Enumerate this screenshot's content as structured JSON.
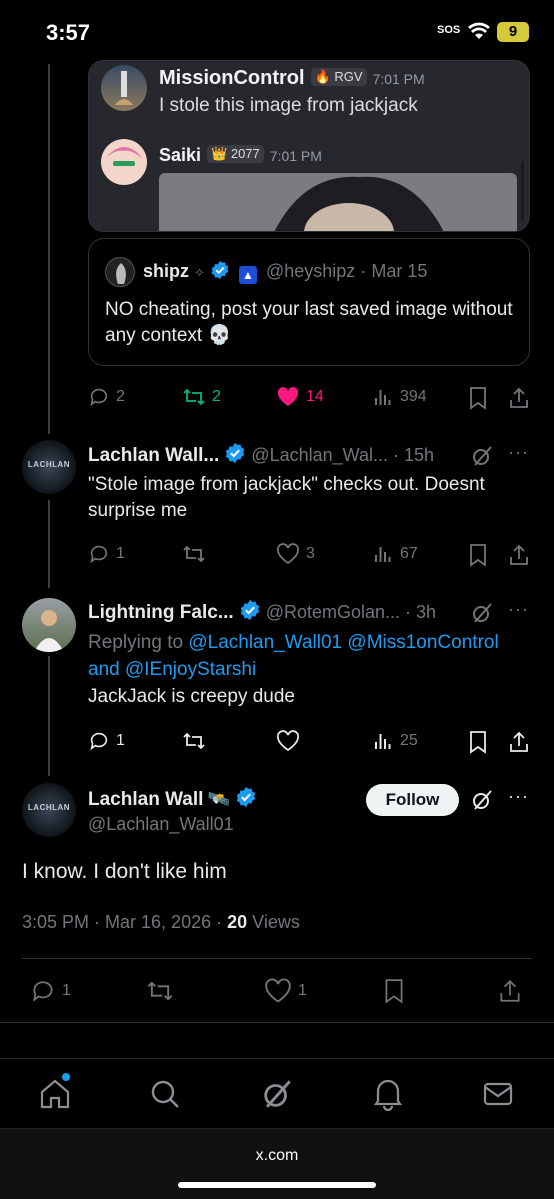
{
  "status_bar": {
    "time": "3:57",
    "sos": "SOS",
    "battery": "9"
  },
  "embedded_image": {
    "messages": [
      {
        "name": "MissionControl",
        "tag": "RGV",
        "time": "7:01 PM",
        "text": "I stole this image from jackjack"
      },
      {
        "name": "Saiki",
        "tag": "2077",
        "time": "7:01 PM"
      }
    ]
  },
  "quoted_tweet": {
    "name": "shipz",
    "handle": "@heyshipz",
    "date": "· Mar 15",
    "text": "NO cheating, post your last saved image without any context 💀"
  },
  "original_actions": {
    "replies": "2",
    "reposts": "2",
    "likes": "14",
    "views": "394"
  },
  "replies": [
    {
      "name": "Lachlan Wall...",
      "handle": "@Lachlan_Wal...",
      "time": "· 15h",
      "text": "\"Stole image from jackjack\" checks out. Doesnt surprise me",
      "replies": "1",
      "reposts": "",
      "likes": "3",
      "views": "67"
    },
    {
      "name": "Lightning Falc...",
      "handle": "@RotemGolan...",
      "time": "· 3h",
      "replying_to_label": "Replying to",
      "replying_to_1": "@Lachlan_Wall01",
      "replying_to_2": "@Miss1onControl",
      "and_label": "and",
      "replying_to_3": "@IEnjoyStarshi",
      "text": "JackJack is creepy dude",
      "replies": "1",
      "reposts": "",
      "likes": "",
      "views": "25"
    }
  ],
  "main_tweet": {
    "name": "Lachlan Wall",
    "handle": "@Lachlan_Wall01",
    "follow_label": "Follow",
    "text": "I know. I don't like him",
    "timestamp": "3:05 PM · Mar 16, 2026 ·",
    "views_count": "20",
    "views_label": "Views",
    "replies": "1",
    "reposts": "",
    "likes": "1"
  },
  "avatar_text": "LACHLAN",
  "browser": {
    "url": "x.com"
  },
  "colors": {
    "bg": "#000000",
    "accent": "#1d9bf0",
    "like": "#f91880",
    "repost": "#00ba7c",
    "gray": "#71767b"
  },
  "icons": [
    "reply-icon",
    "repost-icon",
    "like-icon",
    "views-icon",
    "bookmark-icon",
    "share-icon",
    "grok-icon",
    "more-icon",
    "verified-icon",
    "home-icon",
    "search-icon",
    "notifications-icon",
    "messages-icon"
  ]
}
